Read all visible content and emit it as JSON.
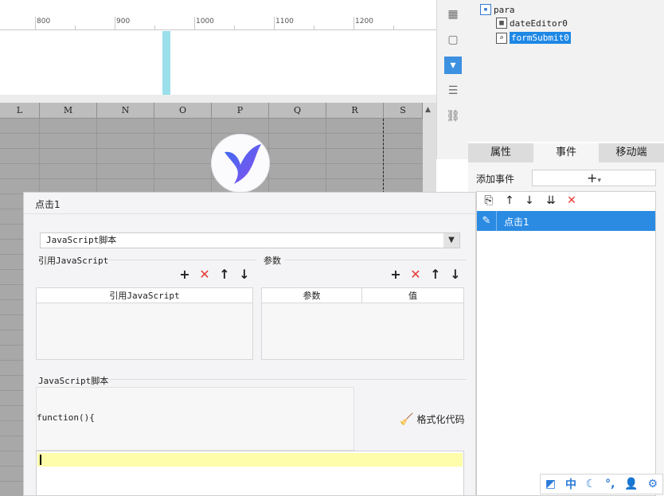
{
  "ruler": {
    "labels": [
      "800",
      "900",
      "1000",
      "1100",
      "1200"
    ]
  },
  "grid": {
    "columns": [
      "L",
      "M",
      "N",
      "O",
      "P",
      "Q",
      "R",
      "S"
    ]
  },
  "widget_tree": {
    "root": "para",
    "children": [
      "dateEditor0",
      "formSubmit0"
    ]
  },
  "right_tabs": [
    "属性",
    "事件",
    "移动端"
  ],
  "events": {
    "add_label": "添加事件",
    "add_button": "+",
    "items": [
      "点击1"
    ]
  },
  "dialog": {
    "title": "点击1",
    "script_type": "JavaScript脚本",
    "ref_js_section": "引用JavaScript",
    "params_section": "参数",
    "ref_js_column": "引用JavaScript",
    "params_columns": [
      "参数",
      "值"
    ],
    "script_section": "JavaScript脚本",
    "code_header": "function(){",
    "format_button": "格式化代码"
  },
  "tray": {
    "ime": "中"
  },
  "colors": {
    "accent": "#2b8be3",
    "delete": "#e53935",
    "editor_line": "#fefdaa"
  }
}
